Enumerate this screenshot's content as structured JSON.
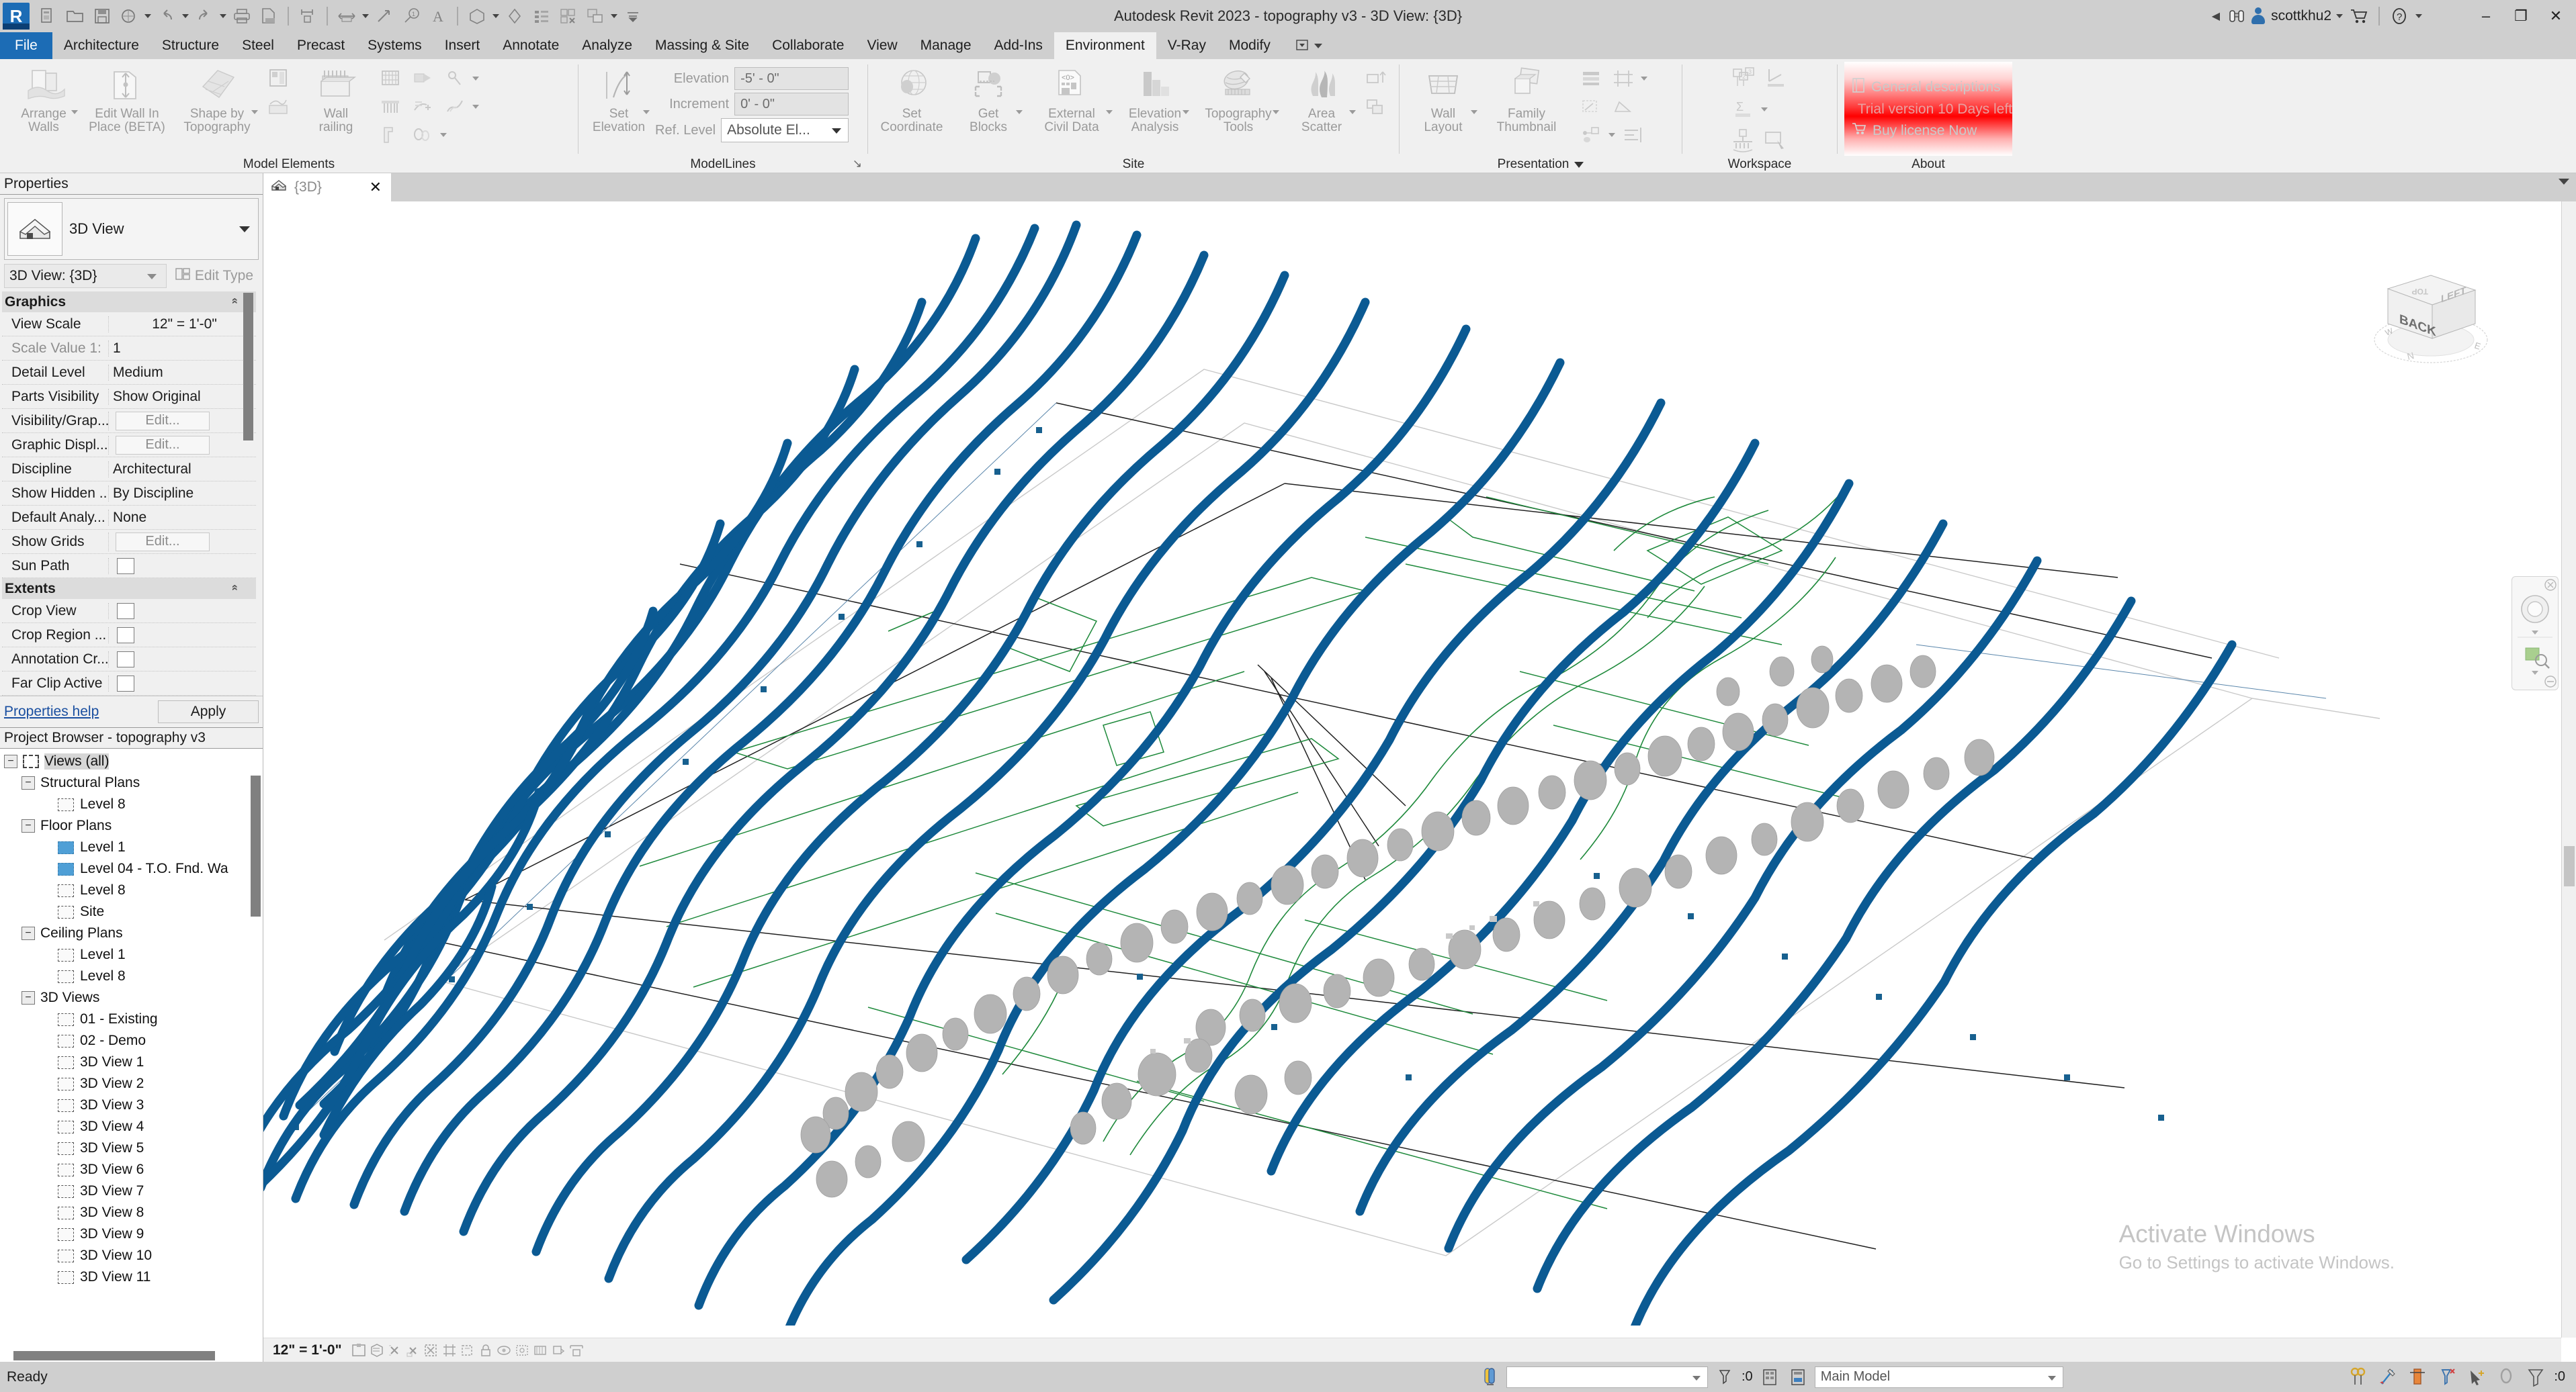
{
  "window": {
    "title": "Autodesk Revit 2023 - topography v3 - 3D View: {3D}",
    "user": "scottkhu2",
    "minimize_label": "–",
    "restore_label": "❐",
    "close_label": "✕"
  },
  "quick_access": {
    "icons": [
      "app-logo",
      "new-sheet-icon",
      "open-icon",
      "save-icon",
      "save-as-icon",
      "undo-icon",
      "redo-icon",
      "print-icon",
      "export-pdf-icon",
      "dimension-icon",
      "measure-icon",
      "aligned-dimension-icon",
      "tag-icon",
      "text-icon",
      "3d-view-icon",
      "section-icon",
      "schedule-icon",
      "close-inactive-icon",
      "switch-window-icon",
      "customize-icon"
    ]
  },
  "ribbon": {
    "tabs": [
      {
        "label": "File",
        "state": "file"
      },
      {
        "label": "Architecture",
        "state": "normal"
      },
      {
        "label": "Structure",
        "state": "normal"
      },
      {
        "label": "Steel",
        "state": "normal"
      },
      {
        "label": "Precast",
        "state": "normal"
      },
      {
        "label": "Systems",
        "state": "normal"
      },
      {
        "label": "Insert",
        "state": "normal"
      },
      {
        "label": "Annotate",
        "state": "normal"
      },
      {
        "label": "Analyze",
        "state": "normal"
      },
      {
        "label": "Massing & Site",
        "state": "normal"
      },
      {
        "label": "Collaborate",
        "state": "normal"
      },
      {
        "label": "View",
        "state": "normal"
      },
      {
        "label": "Manage",
        "state": "normal"
      },
      {
        "label": "Add-Ins",
        "state": "normal"
      },
      {
        "label": "Environment",
        "state": "active"
      },
      {
        "label": "V-Ray",
        "state": "normal"
      },
      {
        "label": "Modify",
        "state": "normal"
      }
    ],
    "panels": {
      "model_elements": {
        "title": "Model Elements",
        "buttons": [
          {
            "label": "Arrange\nWalls",
            "icon": "arrange-walls-icon",
            "caret": true
          },
          {
            "label": "Edit Wall In\nPlace (BETA)",
            "icon": "edit-wall-in-place-icon",
            "caret": false
          },
          {
            "label": "Shape by\nTopography",
            "icon": "shape-by-topography-icon",
            "caret": true
          },
          {
            "label": "Wall\nrailing",
            "icon": "wall-railing-icon",
            "caret": false
          }
        ],
        "small_icons_a": [
          "wall-panel-icon",
          "wall-sweep-icon"
        ],
        "small_icons_b": [
          "railing-grid-icon",
          "railing-bars-icon",
          "wall-corner-icon"
        ],
        "small_icons_c": [
          "wall-tag-icon",
          "rotate-point-icon",
          "wall-split-icon",
          "wall-wave-icon",
          "wall-mirror-icon"
        ]
      },
      "modellines": {
        "title": "ModelLines",
        "set_elevation_label": "Set\nElevation",
        "fields": [
          {
            "label": "Elevation",
            "value": "-5' - 0\"",
            "type": "text"
          },
          {
            "label": "Increment",
            "value": "0' - 0\"",
            "type": "text"
          },
          {
            "label": "Ref. Level",
            "value": "Absolute El...",
            "type": "select"
          }
        ],
        "dialog_launcher": "↘"
      },
      "site": {
        "title": "Site",
        "buttons": [
          {
            "label": "Set\nCoordinate",
            "icon": "set-coordinate-icon",
            "caret": false
          },
          {
            "label": "Get\nBlocks",
            "icon": "get-blocks-icon",
            "caret": true
          },
          {
            "label": "External\nCivil Data",
            "icon": "external-civil-data-icon",
            "caret": true
          },
          {
            "label": "Elevation\nAnalysis",
            "icon": "elevation-analysis-icon",
            "caret": true
          },
          {
            "label": "Topography\nTools",
            "icon": "topography-tools-icon",
            "caret": true
          },
          {
            "label": "Area\nScatter",
            "icon": "area-scatter-icon",
            "caret": true
          }
        ],
        "small_icons": [
          "extrude-up-icon",
          "overlap-shapes-icon"
        ]
      },
      "presentation": {
        "title": "Presentation",
        "title_caret": true,
        "buttons": [
          {
            "label": "Wall\nLayout",
            "icon": "wall-layout-icon",
            "caret": true
          },
          {
            "label": "Family\nThumbnail",
            "icon": "family-thumbnail-icon",
            "caret": false
          }
        ],
        "small_icons": [
          "stacked-list-icon",
          "crop-frame-icon",
          "ramp-icon",
          "node-graph-icon",
          "align-right-icon"
        ]
      },
      "workspace": {
        "title": "Workspace",
        "small_icons": [
          "numbered-tags-icon",
          "angle-dim-icon",
          "sum-icon",
          "load-down-icon",
          "select-box-icon"
        ]
      },
      "about": {
        "title": "About",
        "items": [
          {
            "label": "General descriptions",
            "icon": "book-icon"
          },
          {
            "label": "Trial version 10 Days left",
            "icon": "none"
          },
          {
            "label": "Buy license Now",
            "icon": "cart-icon"
          }
        ]
      }
    }
  },
  "properties": {
    "header": "Properties",
    "type_name": "3D View",
    "selector_value": "3D View: {3D}",
    "edit_type_label": "Edit Type",
    "groups": [
      {
        "name": "Graphics",
        "rows": [
          {
            "name": "View Scale",
            "value": "12\" = 1'-0\"",
            "kind": "text",
            "center": true
          },
          {
            "name": "Scale Value      1:",
            "value": "1",
            "kind": "text",
            "dim": true
          },
          {
            "name": "Detail Level",
            "value": "Medium",
            "kind": "text"
          },
          {
            "name": "Parts Visibility",
            "value": "Show Original",
            "kind": "text"
          },
          {
            "name": "Visibility/Grap...",
            "value": "Edit...",
            "kind": "button"
          },
          {
            "name": "Graphic Displ...",
            "value": "Edit...",
            "kind": "button"
          },
          {
            "name": "Discipline",
            "value": "Architectural",
            "kind": "text"
          },
          {
            "name": "Show Hidden ...",
            "value": "By Discipline",
            "kind": "text"
          },
          {
            "name": "Default Analy...",
            "value": "None",
            "kind": "text"
          },
          {
            "name": "Show Grids",
            "value": "Edit...",
            "kind": "button"
          },
          {
            "name": "Sun Path",
            "value": "",
            "kind": "checkbox"
          }
        ]
      },
      {
        "name": "Extents",
        "rows": [
          {
            "name": "Crop View",
            "value": "",
            "kind": "checkbox"
          },
          {
            "name": "Crop Region ...",
            "value": "",
            "kind": "checkbox"
          },
          {
            "name": "Annotation Cr...",
            "value": "",
            "kind": "checkbox"
          },
          {
            "name": "Far Clip Active",
            "value": "",
            "kind": "checkbox"
          }
        ]
      }
    ],
    "help_link": "Properties help",
    "apply_label": "Apply"
  },
  "project_browser": {
    "header": "Project Browser - topography v3",
    "tree": [
      {
        "label": "Views (all)",
        "depth": 0,
        "icon": "views-all-icon",
        "expander": "minus",
        "selected": true
      },
      {
        "label": "Structural Plans",
        "depth": 1,
        "icon": "none",
        "expander": "minus",
        "selected": false
      },
      {
        "label": "Level 8",
        "depth": 2,
        "icon": "view-icon",
        "expander": "none",
        "selected": false
      },
      {
        "label": "Floor Plans",
        "depth": 1,
        "icon": "none",
        "expander": "minus",
        "selected": false
      },
      {
        "label": "Level 1",
        "depth": 2,
        "icon": "view-icon-blue",
        "expander": "none",
        "selected": false
      },
      {
        "label": "Level 04 - T.O. Fnd. Wa",
        "depth": 2,
        "icon": "view-icon-blue",
        "expander": "none",
        "selected": false
      },
      {
        "label": "Level 8",
        "depth": 2,
        "icon": "view-icon",
        "expander": "none",
        "selected": false
      },
      {
        "label": "Site",
        "depth": 2,
        "icon": "view-icon",
        "expander": "none",
        "selected": false
      },
      {
        "label": "Ceiling Plans",
        "depth": 1,
        "icon": "none",
        "expander": "minus",
        "selected": false
      },
      {
        "label": "Level 1",
        "depth": 2,
        "icon": "view-icon",
        "expander": "none",
        "selected": false
      },
      {
        "label": "Level 8",
        "depth": 2,
        "icon": "view-icon",
        "expander": "none",
        "selected": false
      },
      {
        "label": "3D Views",
        "depth": 1,
        "icon": "none",
        "expander": "minus",
        "selected": false
      },
      {
        "label": "01 - Existing",
        "depth": 2,
        "icon": "view-icon",
        "expander": "none",
        "selected": false
      },
      {
        "label": "02 - Demo",
        "depth": 2,
        "icon": "view-icon",
        "expander": "none",
        "selected": false
      },
      {
        "label": "3D View 1",
        "depth": 2,
        "icon": "view-icon",
        "expander": "none",
        "selected": false
      },
      {
        "label": "3D View 2",
        "depth": 2,
        "icon": "view-icon",
        "expander": "none",
        "selected": false
      },
      {
        "label": "3D View 3",
        "depth": 2,
        "icon": "view-icon",
        "expander": "none",
        "selected": false
      },
      {
        "label": "3D View 4",
        "depth": 2,
        "icon": "view-icon",
        "expander": "none",
        "selected": false
      },
      {
        "label": "3D View 5",
        "depth": 2,
        "icon": "view-icon",
        "expander": "none",
        "selected": false
      },
      {
        "label": "3D View 6",
        "depth": 2,
        "icon": "view-icon",
        "expander": "none",
        "selected": false
      },
      {
        "label": "3D View 7",
        "depth": 2,
        "icon": "view-icon",
        "expander": "none",
        "selected": false
      },
      {
        "label": "3D View 8",
        "depth": 2,
        "icon": "view-icon",
        "expander": "none",
        "selected": false
      },
      {
        "label": "3D View 9",
        "depth": 2,
        "icon": "view-icon",
        "expander": "none",
        "selected": false
      },
      {
        "label": "3D View 10",
        "depth": 2,
        "icon": "view-icon",
        "expander": "none",
        "selected": false
      },
      {
        "label": "3D View 11",
        "depth": 2,
        "icon": "view-icon",
        "expander": "none",
        "selected": false
      }
    ]
  },
  "view": {
    "tab_label": "{3D}",
    "tab_icon": "home-3d-icon",
    "close_label": "✕",
    "viewcube": {
      "front": "BACK",
      "side": "LEFT",
      "top": "TOP",
      "compass": [
        "N",
        "E",
        "S",
        "W"
      ]
    },
    "control_bar": {
      "scale": "12\" = 1'-0\"",
      "icons": [
        "detail-level-icon",
        "visual-style-icon",
        "sun-path-icon",
        "shadows-icon",
        "render-dialog-icon",
        "crop-view-icon",
        "show-crop-icon",
        "lock-3d-icon",
        "temp-hide-icon",
        "reveal-hidden-icon",
        "analytical-model-icon",
        "constraints-icon",
        "worksharing-icon"
      ]
    },
    "watermark": {
      "line1": "Activate Windows",
      "line2": "Go to Settings to activate Windows."
    }
  },
  "status_bar": {
    "message": "Ready",
    "combo_value": "",
    "filter_count": ":0",
    "worksets_value": "Main Model",
    "right_icons": [
      "design-options-icon",
      "edit-part-icon",
      "exclude-icon",
      "filter-pin-icon",
      "select-underlay-icon",
      "select-pinned-icon",
      "filter-icon"
    ],
    "filter_badge": ":0"
  },
  "colors": {
    "accent": "#1c6cb5",
    "contour_blue": "#0b5a93",
    "contour_green": "#1f8a3c",
    "survey_black": "#202020",
    "tree_gray": "#b4b4b4",
    "chrome": "#cfcfcf",
    "ribbon_bg": "#f0f0f0",
    "trial_red": "#ff0000"
  }
}
